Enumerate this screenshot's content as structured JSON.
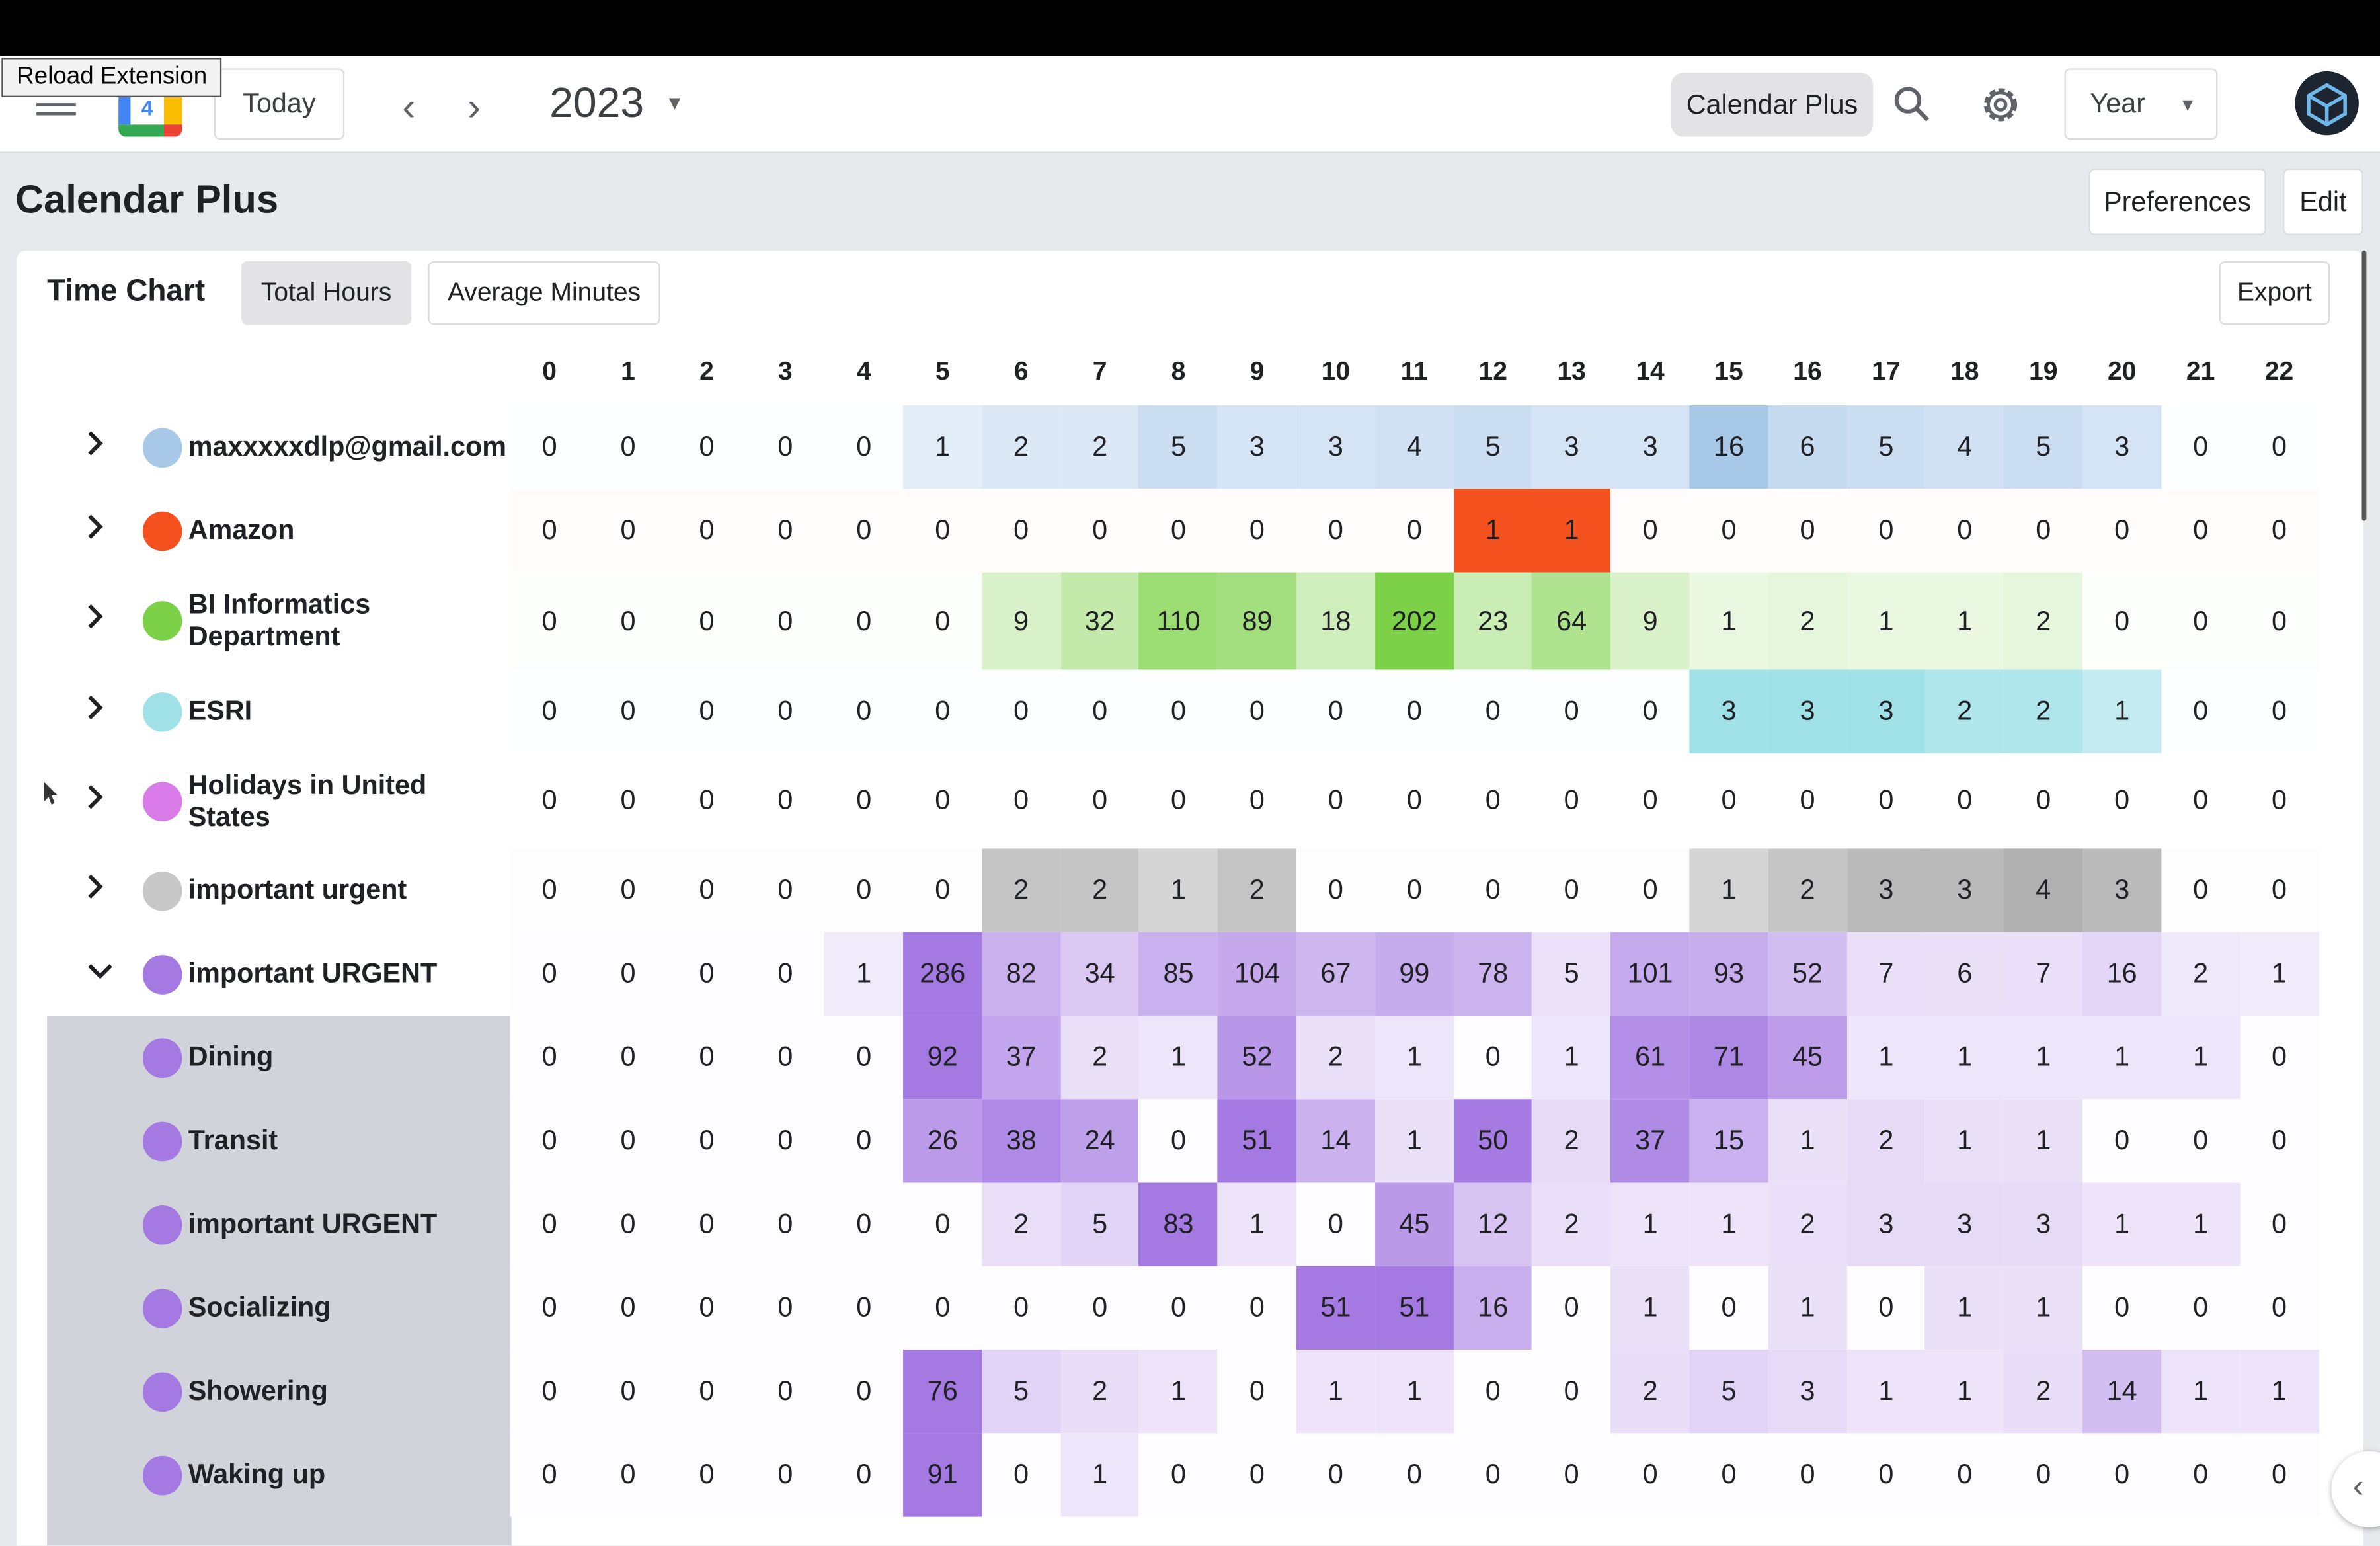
{
  "extension_button": "Reload Extension",
  "topbar": {
    "today_label": "Today",
    "year_label": "2023",
    "calendar_plus_label": "Calendar Plus",
    "view_select": "Year",
    "app_badge": "4"
  },
  "header": {
    "title": "Calendar Plus",
    "preferences_label": "Preferences",
    "edit_label": "Edit"
  },
  "chart": {
    "title": "Time Chart",
    "tab_total": "Total Hours",
    "tab_average": "Average Minutes",
    "export_label": "Export",
    "columns": [
      "0",
      "1",
      "2",
      "3",
      "4",
      "5",
      "6",
      "7",
      "8",
      "9",
      "10",
      "11",
      "12",
      "13",
      "14",
      "15",
      "16",
      "17",
      "18",
      "19",
      "20",
      "21",
      "22"
    ]
  },
  "rows": [
    {
      "label": "maxxxxxdlp@gmail.com",
      "color": "#a8c8e8",
      "expanded": false,
      "sub": false,
      "values": [
        0,
        0,
        0,
        0,
        0,
        1,
        2,
        2,
        5,
        3,
        3,
        4,
        5,
        3,
        3,
        16,
        6,
        5,
        4,
        5,
        3,
        0,
        0
      ]
    },
    {
      "label": "Amazon",
      "color": "#f4511e",
      "expanded": false,
      "sub": false,
      "values": [
        0,
        0,
        0,
        0,
        0,
        0,
        0,
        0,
        0,
        0,
        0,
        0,
        1,
        1,
        0,
        0,
        0,
        0,
        0,
        0,
        0,
        0,
        0
      ]
    },
    {
      "label": "BI Informatics Department",
      "color": "#7cd148",
      "expanded": false,
      "sub": false,
      "values": [
        0,
        0,
        0,
        0,
        0,
        0,
        9,
        32,
        110,
        89,
        18,
        202,
        23,
        64,
        9,
        1,
        2,
        1,
        1,
        2,
        0,
        0,
        0
      ]
    },
    {
      "label": "ESRI",
      "color": "#9fe1e7",
      "expanded": false,
      "sub": false,
      "values": [
        0,
        0,
        0,
        0,
        0,
        0,
        0,
        0,
        0,
        0,
        0,
        0,
        0,
        0,
        0,
        3,
        3,
        3,
        2,
        2,
        1,
        0,
        0
      ]
    },
    {
      "label": "Holidays in United States",
      "color": "#d87ae8",
      "expanded": false,
      "sub": false,
      "values": [
        0,
        0,
        0,
        0,
        0,
        0,
        0,
        0,
        0,
        0,
        0,
        0,
        0,
        0,
        0,
        0,
        0,
        0,
        0,
        0,
        0,
        0,
        0
      ]
    },
    {
      "label": "important urgent",
      "color": "#c8c8c8",
      "expanded": false,
      "sub": false,
      "values": [
        0,
        0,
        0,
        0,
        0,
        0,
        2,
        2,
        1,
        2,
        0,
        0,
        0,
        0,
        0,
        1,
        2,
        3,
        3,
        4,
        3,
        0,
        0
      ]
    },
    {
      "label": "important URGENT",
      "color": "#a479e2",
      "expanded": true,
      "sub": false,
      "values": [
        0,
        0,
        0,
        0,
        1,
        286,
        82,
        34,
        85,
        104,
        67,
        99,
        78,
        5,
        101,
        93,
        52,
        7,
        6,
        7,
        16,
        2,
        1
      ]
    },
    {
      "label": "Dining",
      "color": "#a479e2",
      "sub": true,
      "values": [
        0,
        0,
        0,
        0,
        0,
        92,
        37,
        2,
        1,
        52,
        2,
        1,
        0,
        1,
        61,
        71,
        45,
        1,
        1,
        1,
        1,
        1,
        0
      ]
    },
    {
      "label": "Transit",
      "color": "#a479e2",
      "sub": true,
      "values": [
        0,
        0,
        0,
        0,
        0,
        26,
        38,
        24,
        0,
        51,
        14,
        1,
        50,
        2,
        37,
        15,
        1,
        2,
        1,
        1,
        0,
        0,
        0
      ]
    },
    {
      "label": "important URGENT",
      "color": "#a479e2",
      "sub": true,
      "values": [
        0,
        0,
        0,
        0,
        0,
        0,
        2,
        5,
        83,
        1,
        0,
        45,
        12,
        2,
        1,
        1,
        2,
        3,
        3,
        3,
        1,
        1,
        0
      ]
    },
    {
      "label": "Socializing",
      "color": "#a479e2",
      "sub": true,
      "values": [
        0,
        0,
        0,
        0,
        0,
        0,
        0,
        0,
        0,
        0,
        51,
        51,
        16,
        0,
        1,
        0,
        1,
        0,
        1,
        1,
        0,
        0,
        0
      ]
    },
    {
      "label": "Showering",
      "color": "#a479e2",
      "sub": true,
      "values": [
        0,
        0,
        0,
        0,
        0,
        76,
        5,
        2,
        1,
        0,
        1,
        1,
        0,
        0,
        2,
        5,
        3,
        1,
        1,
        2,
        14,
        1,
        1
      ]
    },
    {
      "label": "Waking up",
      "color": "#a479e2",
      "sub": true,
      "values": [
        0,
        0,
        0,
        0,
        0,
        91,
        0,
        1,
        0,
        0,
        0,
        0,
        0,
        0,
        0,
        0,
        0,
        0,
        0,
        0,
        0,
        0,
        0
      ]
    }
  ]
}
